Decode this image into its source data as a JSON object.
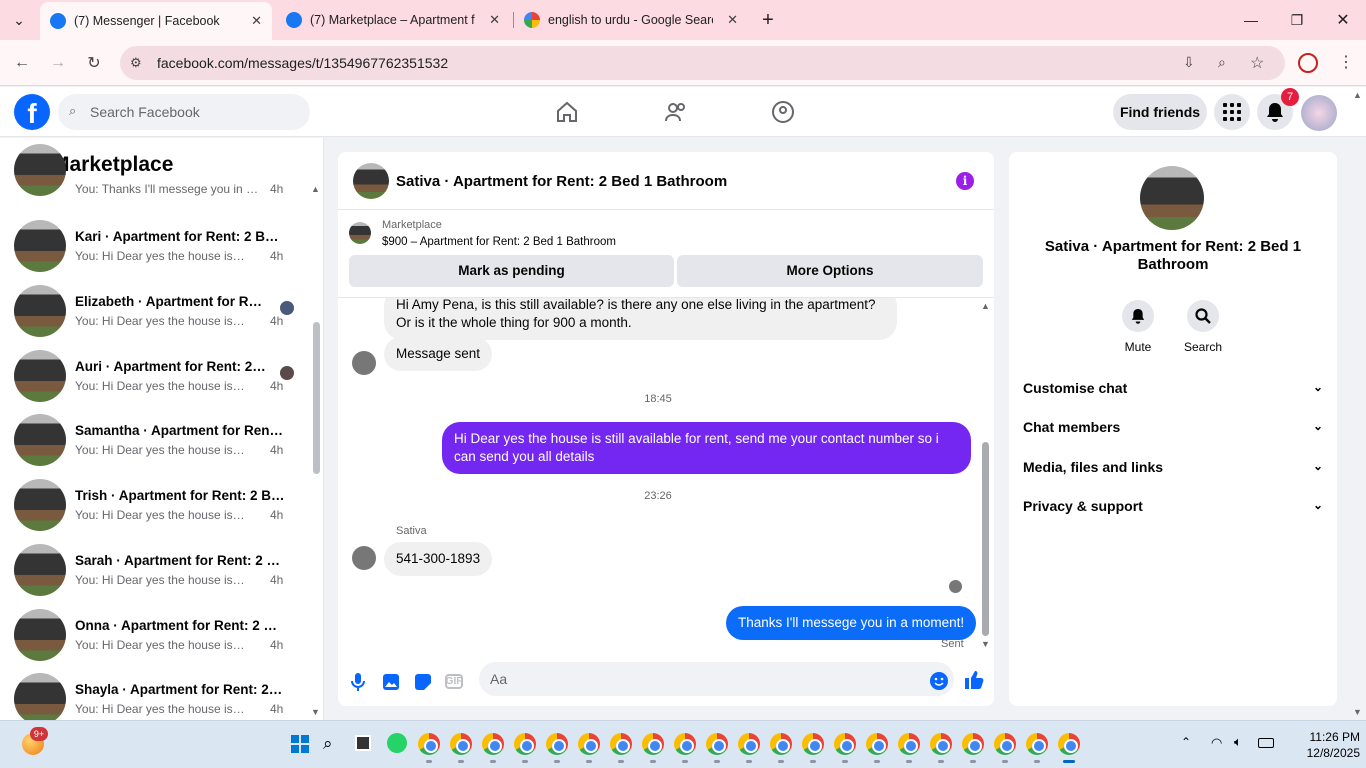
{
  "browser": {
    "tabs": [
      {
        "title": "(7) Messenger | Facebook",
        "active": true
      },
      {
        "title": "(7) Marketplace – Apartment fo",
        "active": false
      },
      {
        "title": "english to urdu - Google Search",
        "active": false
      }
    ],
    "new_tab": "+",
    "url": "facebook.com/messages/t/1354967762351532"
  },
  "fb": {
    "search_placeholder": "Search Facebook",
    "find_friends": "Find friends",
    "notification_count": "7"
  },
  "sidebar": {
    "title": "Marketplace",
    "conversations": [
      {
        "name": "",
        "preview": "You: Thanks I'll messege you in a ...",
        "time": "4h"
      },
      {
        "name": "Kari · Apartment for Rent: 2 Bed...",
        "preview": "You: Hi Dear yes the house is still a...",
        "time": "4h"
      },
      {
        "name": "Elizabeth · Apartment for Ren...",
        "preview": "You: Hi Dear yes the house is stil...",
        "time": "4h"
      },
      {
        "name": "Auri · Apartment for Rent: 2 B...",
        "preview": "You: Hi Dear yes the house is stil...",
        "time": "4h"
      },
      {
        "name": "Samantha · Apartment for Rent:...",
        "preview": "You: Hi Dear yes the house is still a...",
        "time": "4h"
      },
      {
        "name": "Trish · Apartment for Rent: 2 Be...",
        "preview": "You: Hi Dear yes the house is still a...",
        "time": "4h"
      },
      {
        "name": "Sarah · Apartment for Rent: 2 B...",
        "preview": "You: Hi Dear yes the house is still a...",
        "time": "4h"
      },
      {
        "name": "Onna · Apartment for Rent: 2 Be...",
        "preview": "You: Hi Dear yes the house is still a...",
        "time": "4h"
      },
      {
        "name": "Shayla · Apartment for Rent: 2 B...",
        "preview": "You: Hi Dear yes the house is still a...",
        "time": "4h"
      }
    ]
  },
  "chat": {
    "title": "Sativa · Apartment for Rent: 2 Bed 1 Bathroom",
    "listing_label": "Marketplace",
    "listing_title": "$900 – Apartment for Rent: 2 Bed 1 Bathroom",
    "mark_pending": "Mark as pending",
    "more_options": "More Options",
    "messages": [
      {
        "text": "Hi Amy Pena, is this still available? is there any one else living in the apartment? Or is it the whole thing for 900 a month."
      },
      {
        "text": "Message sent"
      },
      {
        "text": "18:45"
      },
      {
        "text": "Hi Dear yes the house is still available for rent, send me your contact number so i can send you all details"
      },
      {
        "text": "23:26"
      },
      {
        "text": "Sativa"
      },
      {
        "text": "541-300-1893"
      },
      {
        "text": "Thanks I'll messege you in a moment!"
      },
      {
        "text": "Sent"
      }
    ],
    "input_placeholder": "Aa"
  },
  "details": {
    "name": "Sativa · Apartment for Rent: 2 Bed 1 Bathroom",
    "mute": "Mute",
    "search": "Search",
    "sections": [
      "Customise chat",
      "Chat members",
      "Media, files and links",
      "Privacy & support"
    ]
  },
  "taskbar": {
    "time": "11:26 PM",
    "date": "12/8/2025",
    "notif_badge": "9+"
  },
  "colors": {
    "outgoing_purple": "#7327f1",
    "outgoing_blue": "#0a6cf8",
    "fb_blue": "#0866ff"
  }
}
